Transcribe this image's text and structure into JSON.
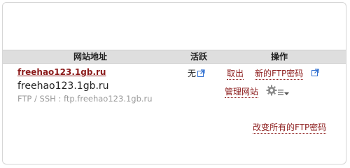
{
  "table": {
    "headers": {
      "site": "网站地址",
      "active": "活跃",
      "actions": "操作"
    },
    "rows": [
      {
        "site_link": "freehao123.1gb.ru",
        "site_name": "freehao123.1gb.ru",
        "ftp_info": "FTP / SSH : ftp.freehao123.1gb.ru",
        "active": "无",
        "actions": {
          "cancel": "取出",
          "new_ftp_password": "新的FTP密码",
          "manage_site": "管理网站"
        }
      }
    ]
  },
  "footer": {
    "change_all_ftp_passwords": "改变所有的FTP密码"
  },
  "colors": {
    "link": "#8b1a1a",
    "header_bg": "#dedede",
    "muted_text": "#9a9a9a",
    "external_icon": "#2f6fd0"
  },
  "icons": {
    "external_link": "external-link-icon",
    "gear": "gear-icon",
    "menu": "menu-icon",
    "dropdown": "chevron-down-icon"
  }
}
